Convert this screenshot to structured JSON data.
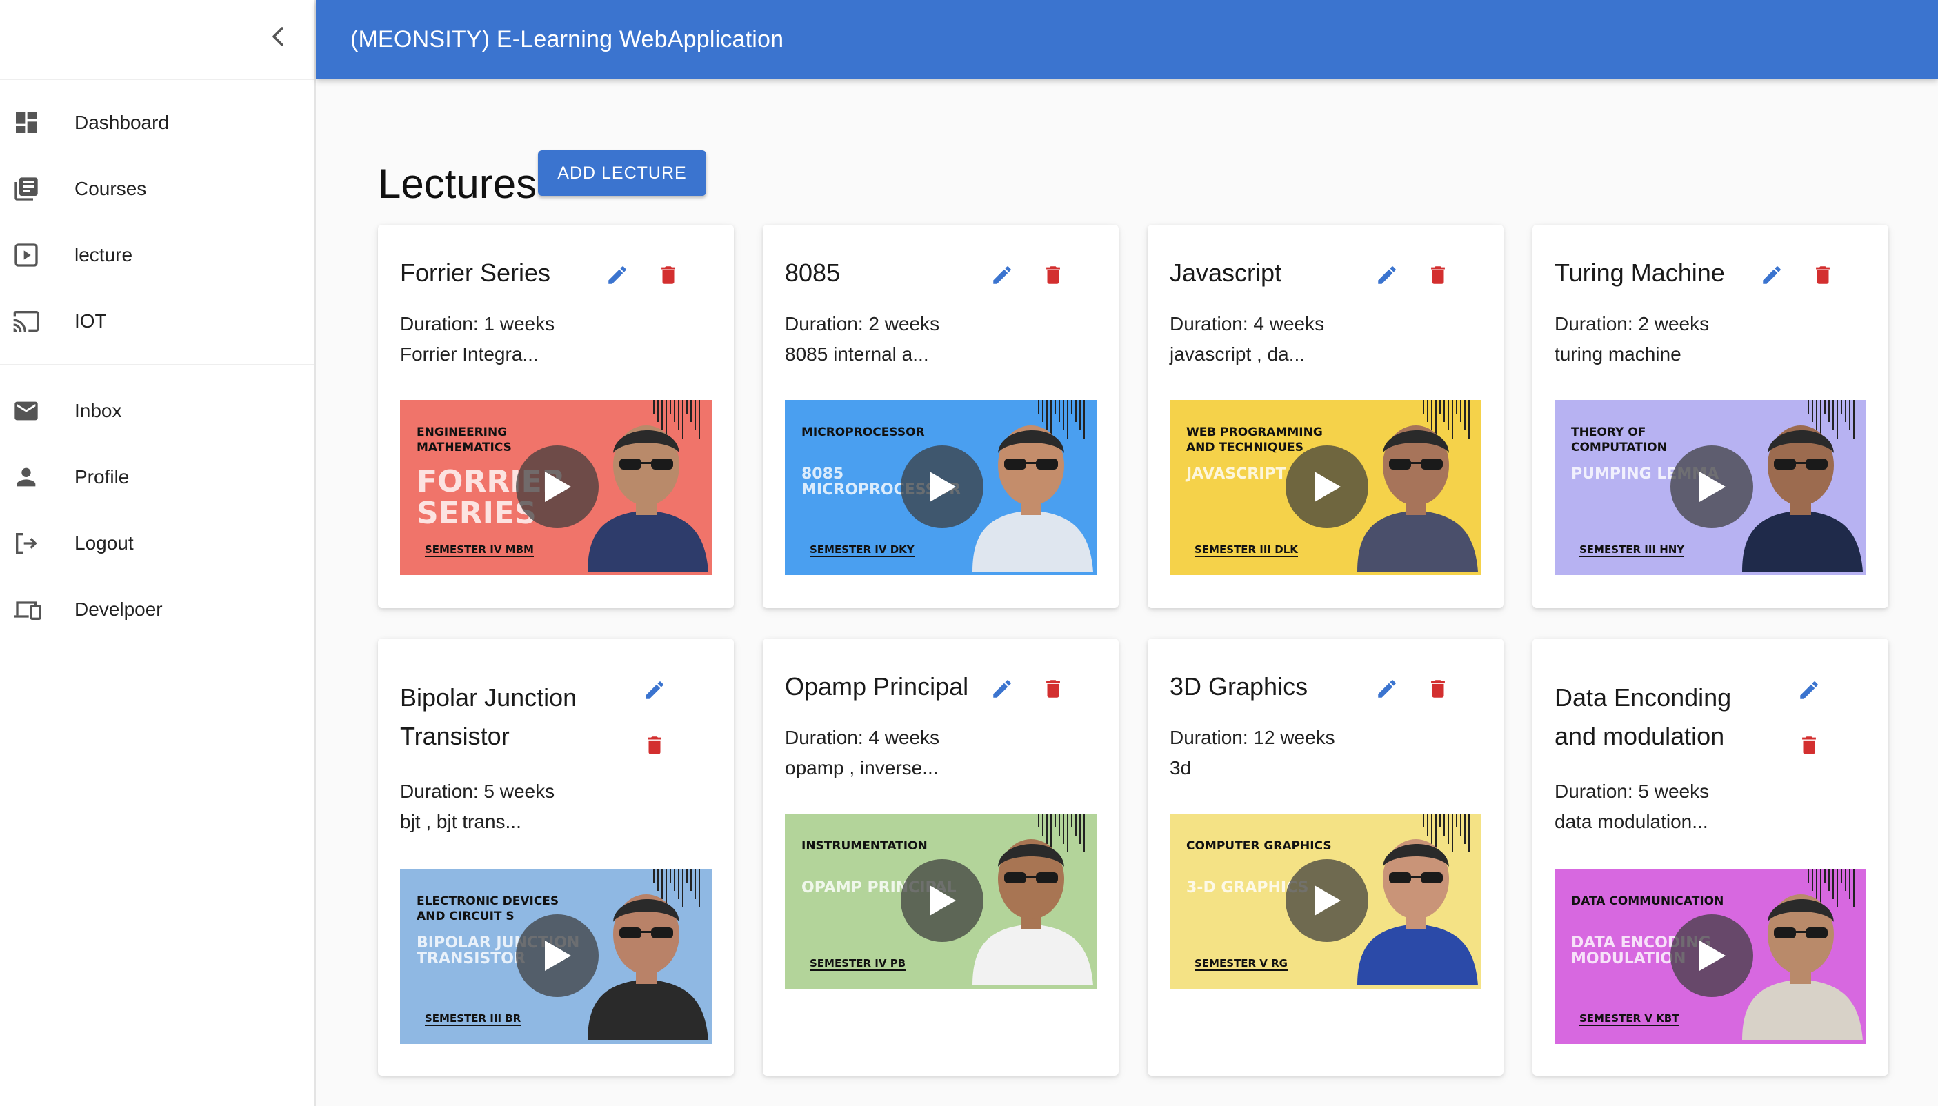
{
  "app": {
    "title": "(MEONSITY) E-Learning WebApplication"
  },
  "sidebar": {
    "primary": [
      {
        "label": "Dashboard",
        "icon": "dashboard-icon"
      },
      {
        "label": "Courses",
        "icon": "library-books-icon"
      },
      {
        "label": "lecture",
        "icon": "play-box-icon"
      },
      {
        "label": "IOT",
        "icon": "cast-icon"
      }
    ],
    "secondary": [
      {
        "label": "Inbox",
        "icon": "mail-icon"
      },
      {
        "label": "Profile",
        "icon": "person-icon"
      },
      {
        "label": "Logout",
        "icon": "logout-icon"
      },
      {
        "label": "Develpoer",
        "icon": "devices-icon"
      }
    ]
  },
  "page": {
    "title": "Lectures",
    "add_button": "ADD LECTURE"
  },
  "colors": {
    "primary": "#3b74cf",
    "delete": "#d32f2f"
  },
  "lectures": [
    {
      "title": "Forrier Series",
      "duration": "Duration: 1 weeks",
      "description": "Forrier Integra...",
      "thumb": {
        "bg": "#f0746a",
        "subject": "ENGINEERING MATHEMATICS",
        "big": "FORRIER SERIES",
        "semester": "SEMESTER IV MBM"
      }
    },
    {
      "title": "8085",
      "duration": "Duration: 2 weeks",
      "description": "8085 internal a...",
      "thumb": {
        "bg": "#4a9ff0",
        "subject": "MICROPROCESSOR",
        "big": "8085 MICROPROCESSOR",
        "semester": "SEMESTER IV DKY"
      }
    },
    {
      "title": "Javascript",
      "duration": "Duration: 4 weeks",
      "description": "javascript , da...",
      "thumb": {
        "bg": "#f5d24a",
        "subject": "WEB PROGRAMMING AND TECHNIQUES",
        "big": "JAVASCRIPT",
        "semester": "SEMESTER III DLK"
      }
    },
    {
      "title": "Turing Machine",
      "duration": "Duration: 2 weeks",
      "description": "turing machine",
      "thumb": {
        "bg": "#b7b2f2",
        "subject": "THEORY OF COMPUTATION",
        "big": "PUMPING LEMMA",
        "semester": "SEMESTER III HNY"
      }
    },
    {
      "title": "Bipolar Junction Transistor",
      "duration": "Duration: 5 weeks",
      "description": "bjt , bjt trans...",
      "thumb": {
        "bg": "#8fb8e3",
        "subject": "ELECTRONIC DEVICES AND CIRCUIT S",
        "big": "BIPOLAR JUNCTION TRANSISTOR",
        "semester": "SEMESTER III BR"
      }
    },
    {
      "title": "Opamp Principal",
      "duration": "Duration: 4 weeks",
      "description": "opamp , inverse...",
      "thumb": {
        "bg": "#b3d49a",
        "subject": "INSTRUMENTATION",
        "big": "OPAMP PRINCIPAL",
        "semester": "SEMESTER IV PB"
      }
    },
    {
      "title": "3D Graphics",
      "duration": "Duration: 12 weeks",
      "description": "3d",
      "thumb": {
        "bg": "#f4e285",
        "subject": "COMPUTER GRAPHICS",
        "big": "3-D GRAPHICS",
        "semester": "SEMESTER V RG"
      }
    },
    {
      "title": "Data Enconding and modulation",
      "duration": "Duration: 5 weeks",
      "description": "data modulation...",
      "thumb": {
        "bg": "#d768e0",
        "subject": "DATA COMMUNICATION",
        "big": "DATA ENCODING MODULATION",
        "semester": "SEMESTER V KBT"
      }
    }
  ]
}
